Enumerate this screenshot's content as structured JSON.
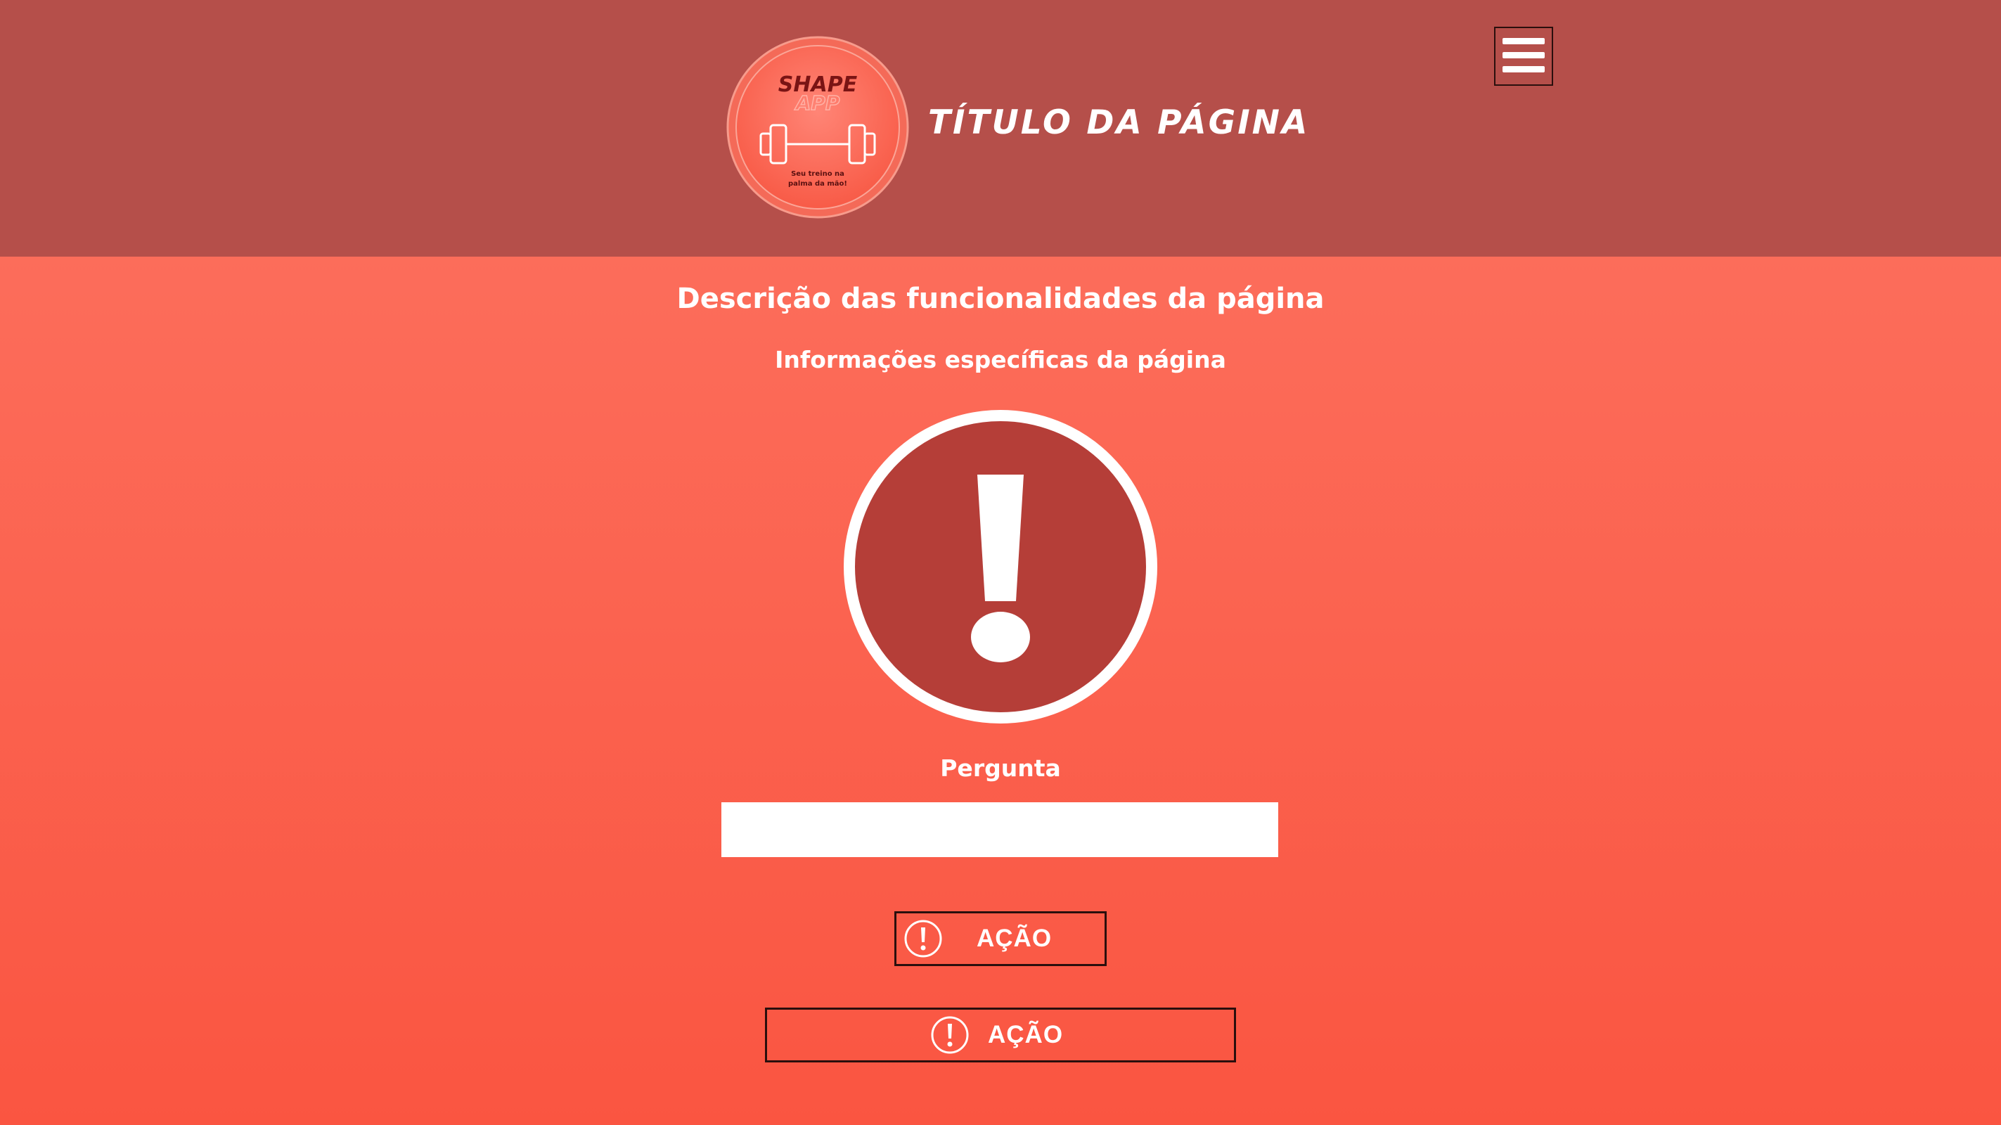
{
  "header": {
    "logo": {
      "brand_line1": "SHAPE",
      "brand_line2": "APP",
      "tagline_line1": "Seu treino na",
      "tagline_line2": "palma da mão!"
    },
    "title": "TÍTULO DA PÁGINA",
    "menu_icon": "hamburger-menu-icon"
  },
  "content": {
    "description": "Descrição das funcionalidades da página",
    "info": "Informações específicas da página",
    "alert_icon": "exclamation-circle-icon",
    "question_label": "Pergunta",
    "answer_value": "",
    "actions": [
      {
        "label": "AÇÃO",
        "icon": "exclamation-circle-icon"
      },
      {
        "label": "AÇÃO",
        "icon": "exclamation-circle-icon"
      }
    ]
  },
  "colors": {
    "header_bg": "#b54f4a",
    "body_gradient_top": "#fd7462",
    "body_gradient_bottom": "#fa5541",
    "alert_fill": "#b53e38",
    "text": "#ffffff",
    "button_border": "#2a0f0d"
  }
}
